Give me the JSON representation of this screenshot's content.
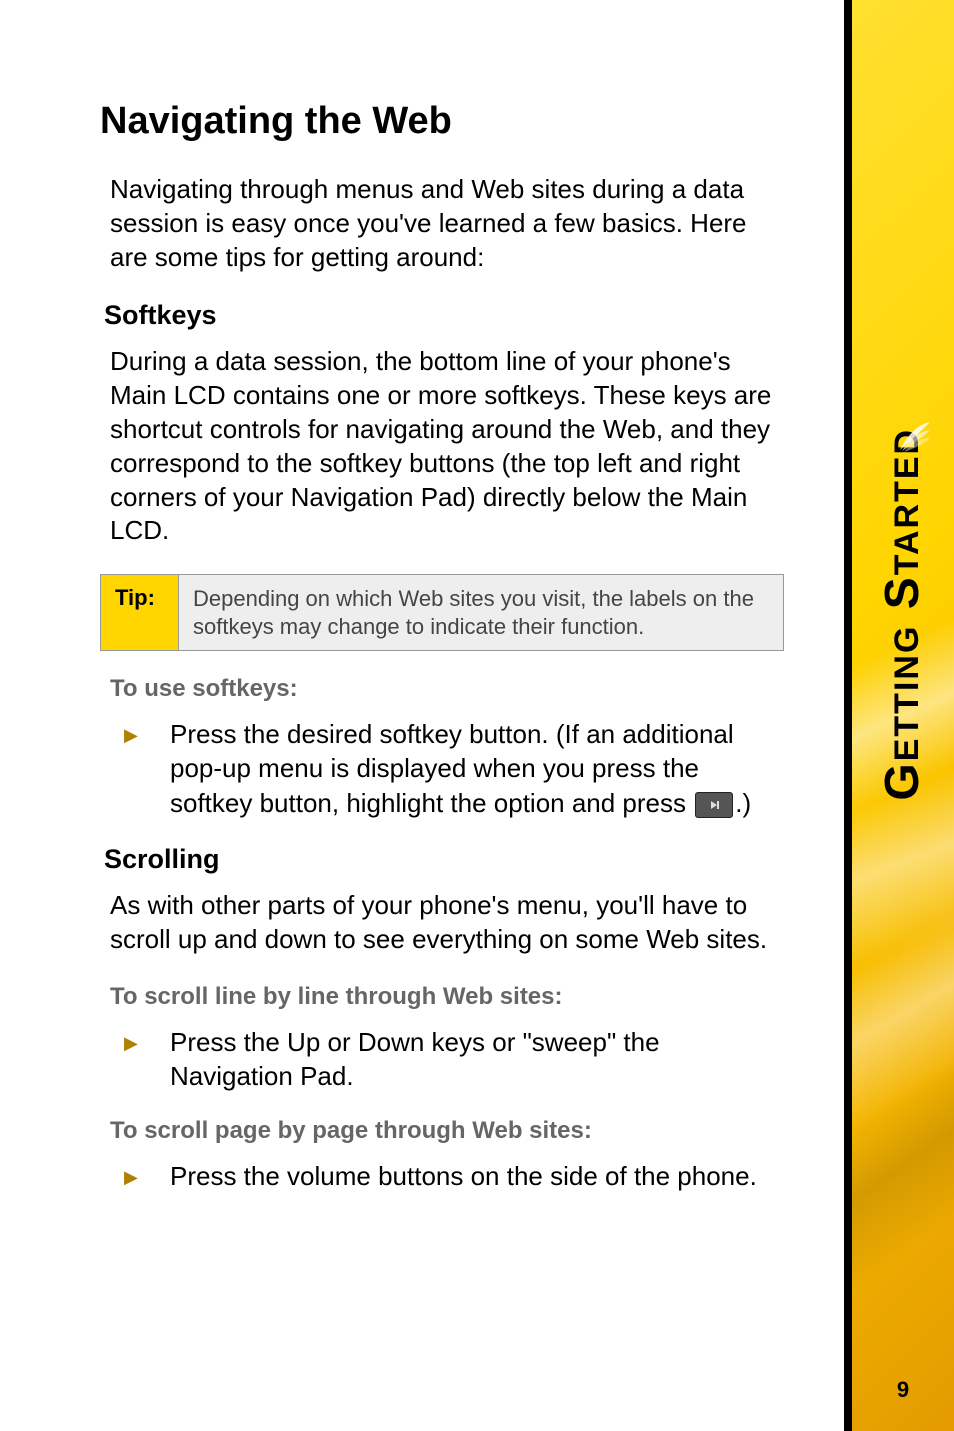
{
  "sideTab": {
    "label": "Getting Started",
    "pageNumber": "9"
  },
  "title": "Navigating the Web",
  "intro": "Navigating through menus and Web sites during a data session is easy once you've learned a few basics. Here are some tips for getting around:",
  "softkeys": {
    "heading": "Softkeys",
    "body": "During a data session, the bottom line of your phone's Main LCD contains one or more softkeys. These keys are shortcut controls for navigating around the Web, and they correspond to the softkey buttons (the top left and right corners of your Navigation Pad) directly below the Main LCD."
  },
  "tip": {
    "label": "Tip:",
    "text": "Depending on which Web sites you visit, the labels on the softkeys may change to indicate their function."
  },
  "useSoftkeys": {
    "lead": "To use softkeys:",
    "item_pre": "Press the desired softkey button. (If an additional pop-up menu is displayed when you press the softkey button, highlight the option and press ",
    "item_post": ".)"
  },
  "scrolling": {
    "heading": "Scrolling",
    "body": "As with other parts of your phone's menu, you'll have to scroll up and down to see everything on some Web sites."
  },
  "lineScroll": {
    "lead": "To scroll line by line through Web sites:",
    "item": "Press the Up or Down keys or \"sweep\" the Navigation Pad."
  },
  "pageScroll": {
    "lead": "To scroll page by page through Web sites:",
    "item": "Press the volume buttons on the side of the phone."
  }
}
